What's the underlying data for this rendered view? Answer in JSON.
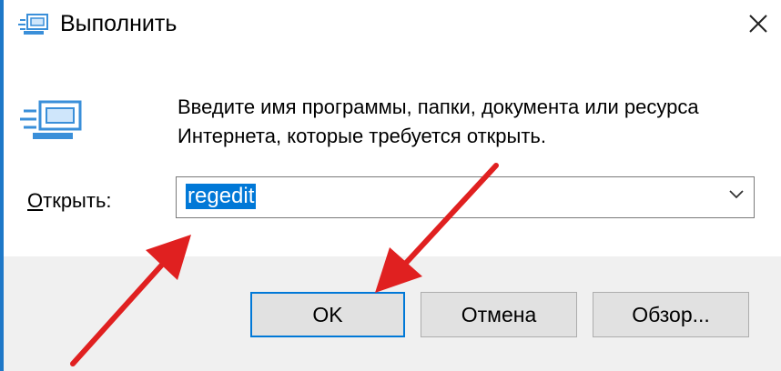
{
  "window": {
    "title": "Выполнить",
    "accent_color": "#1e78c8",
    "close_icon": "close-icon"
  },
  "dialog": {
    "description": "Введите имя программы, папки, документа или ресурса Интернета, которые требуется открыть.",
    "open_label_accel": "О",
    "open_label_rest": "ткрыть:",
    "input_value": "regedit",
    "selection_color": "#0078d7"
  },
  "buttons": {
    "ok": "OK",
    "cancel": "Отмена",
    "browse": "Обзор..."
  },
  "annotation": {
    "arrow_color": "#e02020"
  }
}
